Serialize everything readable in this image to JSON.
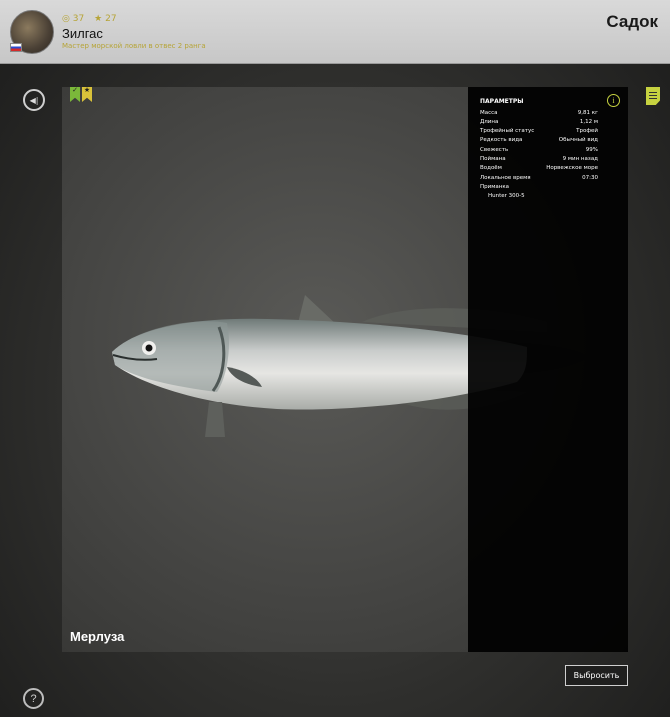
{
  "header": {
    "title": "Садок",
    "player": {
      "name": "Зилгас",
      "rank_text": "Мастер морской ловли в отвес 2 ранга",
      "level": "37",
      "trophies": "27"
    }
  },
  "fish": {
    "name": "Мерлуза"
  },
  "params": {
    "title": "ПАРАМЕТРЫ",
    "rows": [
      {
        "label": "Масса",
        "value": "9,81 кг"
      },
      {
        "label": "Длина",
        "value": "1,12 м"
      },
      {
        "label": "Трофейный статус",
        "value": "Трофей"
      },
      {
        "label": "Редкость вида",
        "value": "Обычный вид"
      },
      {
        "label": "Свежесть",
        "value": "99%"
      },
      {
        "label": "Поймана",
        "value": "9 мин назад"
      },
      {
        "label": "Водоём",
        "value": "Норвежское море"
      },
      {
        "label": "Локальное время",
        "value": "07:30"
      }
    ],
    "bait_label": "Приманка",
    "bait_value": "Hunter 300-5"
  },
  "actions": {
    "release_label": "Выбросить"
  },
  "icons": {
    "back": "sound-icon",
    "help": "help-icon",
    "notes": "notes-icon",
    "info": "info-icon"
  },
  "colors": {
    "accent": "#c6d240",
    "gold": "#b6a437"
  }
}
